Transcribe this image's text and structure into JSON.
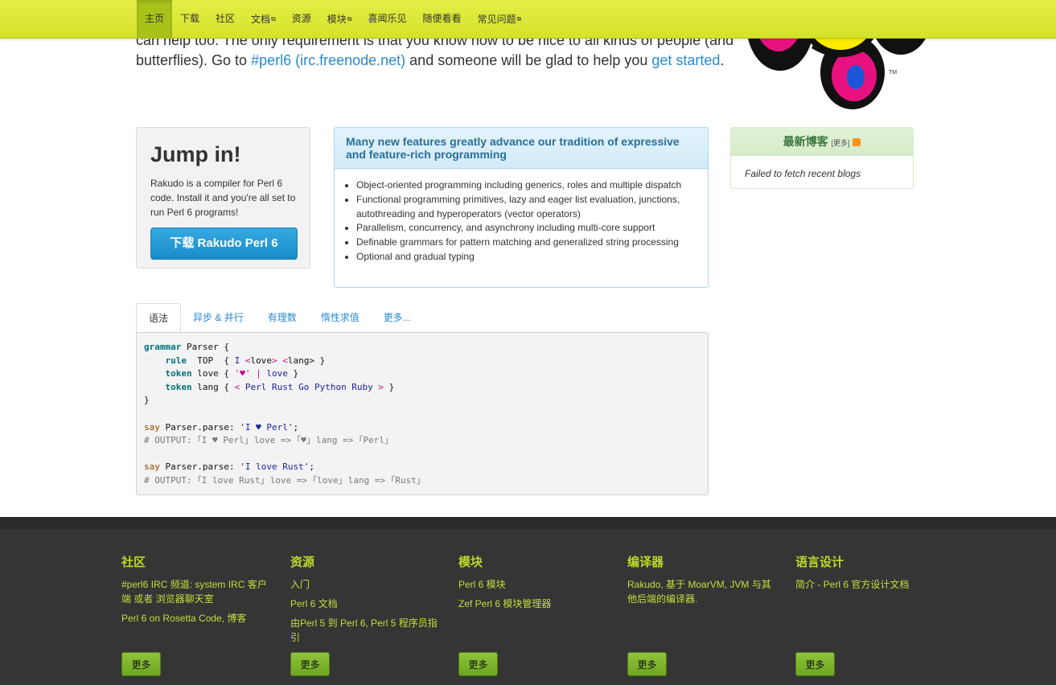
{
  "nav": {
    "items": [
      {
        "label": "主页",
        "active": true,
        "external": false
      },
      {
        "label": "下载",
        "active": false,
        "external": false
      },
      {
        "label": "社区",
        "active": false,
        "external": false
      },
      {
        "label": "文档",
        "active": false,
        "external": true
      },
      {
        "label": "资源",
        "active": false,
        "external": false
      },
      {
        "label": "模块",
        "active": false,
        "external": true
      },
      {
        "label": "喜闻乐见",
        "active": false,
        "external": false
      },
      {
        "label": "随便看看",
        "active": false,
        "external": false
      },
      {
        "label": "常见问题",
        "active": false,
        "external": true
      }
    ]
  },
  "intro": {
    "line1": "can help too. The only requirement is that you know how to be nice to all kinds of people (and",
    "line2_pre": "butterflies). Go to ",
    "irc_link": "#perl6 (irc.freenode.net)",
    "line2_mid": " and someone will be glad to help you ",
    "started_link": "get started",
    "line2_post": "."
  },
  "butterfly": {
    "tm": "TM"
  },
  "jump": {
    "title": "Jump in!",
    "text": "Rakudo is a compiler for Perl 6 code. Install it and you're all set to run Perl 6 programs!",
    "button": "下载 Rakudo Perl 6"
  },
  "features": {
    "heading": "Many new features greatly advance our tradition of expressive and feature-rich programming",
    "items": [
      "Object-oriented programming including generics, roles and multiple dispatch",
      "Functional programming primitives, lazy and eager list evaluation, junctions, autothreading and hyperoperators (vector operators)",
      "Parallelism, concurrency, and asynchrony including multi-core support",
      "Definable grammars for pattern matching and generalized string processing",
      "Optional and gradual typing"
    ]
  },
  "blog": {
    "title": "最新博客",
    "more": "[更多]",
    "message": "Failed to fetch recent blogs"
  },
  "tabs": {
    "items": [
      "语法",
      "异步 & 并行",
      "有理数",
      "惰性求值",
      "更多..."
    ],
    "active": 0
  },
  "code": {
    "l1_kw": "grammar",
    "l1_rest": " Parser {",
    "l2_kw": "rule",
    "l2_a": "  TOP  { ",
    "l2_b": "I ",
    "l2_c": "<",
    "l2_d": "love",
    "l2_e": "> ",
    "l2_f": "<",
    "l2_g": "lang",
    "l2_h": "> }",
    "l3_kw": "token",
    "l3_a": " love { ",
    "l3_b": "'♥'",
    "l3_c": " | ",
    "l3_d": "love",
    "l3_e": " }",
    "l4_kw": "token",
    "l4_a": " lang { ",
    "l4_b": "<",
    "l4_c": " Perl Rust Go Python Ruby ",
    "l4_d": ">",
    "l4_e": " }",
    "l5": "}",
    "l7_kw": "say",
    "l7_a": " Parser.parse: ",
    "l7_b": "'I ♥ Perl'",
    "l7_c": ";",
    "l8": "# OUTPUT: ｢I ♥ Perl｣ love => ｢♥｣ lang => ｢Perl｣",
    "l10_kw": "say",
    "l10_a": " Parser.parse: ",
    "l10_b": "'I love Rust'",
    "l10_c": ";",
    "l11": "# OUTPUT: ｢I love Rust｣ love => ｢love｣ lang => ｢Rust｣"
  },
  "footer": {
    "more_button": "更多",
    "cols": [
      {
        "title": "社区",
        "links": [
          "#perl6 IRC 频道: system IRC 客户端 或者 浏览器聊天室",
          "Perl 6 on Rosetta Code, 博客"
        ]
      },
      {
        "title": "资源",
        "links": [
          "入门",
          "Perl 6 文档",
          "由Perl 5 到 Perl 6, Perl 5 程序员指引"
        ]
      },
      {
        "title": "模块",
        "links": [
          "Perl 6 模块",
          "Zef Perl 6 模块管理器"
        ]
      },
      {
        "title": "编译器",
        "links": [
          "Rakudo, 基于 MoarVM, JVM 与其他后端的编译器."
        ]
      },
      {
        "title": "语言设计",
        "links": [
          "简介 - Perl 6 官方设计文档"
        ]
      }
    ]
  }
}
